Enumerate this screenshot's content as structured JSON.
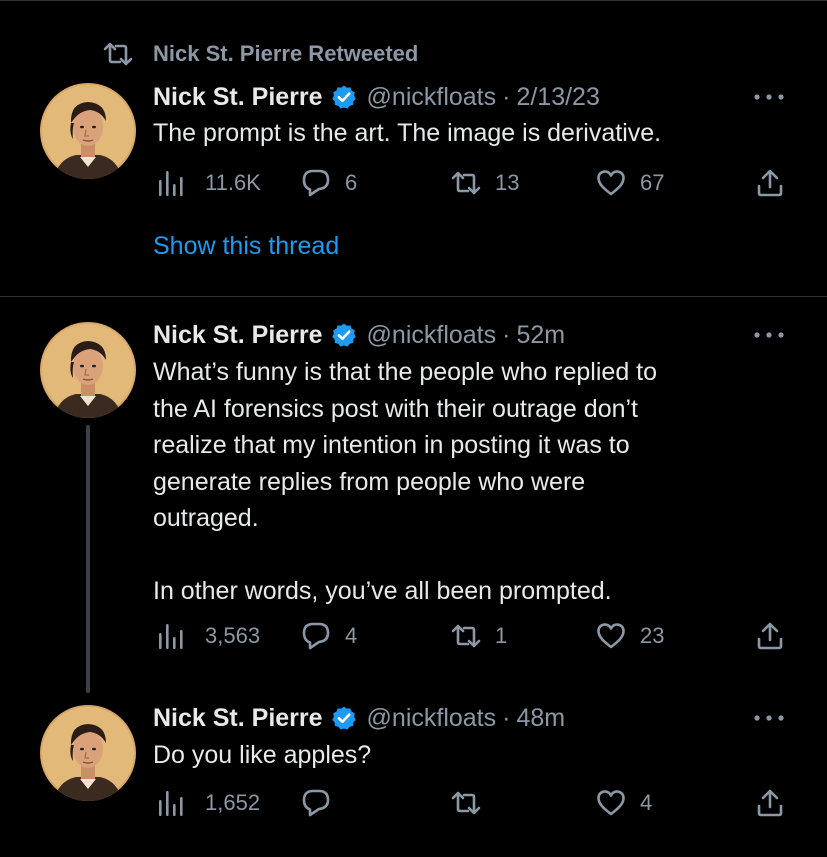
{
  "retweet_banner": {
    "text": "Nick St. Pierre Retweeted"
  },
  "tweets": [
    {
      "name": "Nick St. Pierre",
      "handle": "@nickfloats",
      "separator": "·",
      "time": "2/13/23",
      "text": "The prompt is the art. The image is derivative.",
      "views": "11.6K",
      "replies": "6",
      "retweets": "13",
      "likes": "67",
      "show_thread": "Show this thread"
    },
    {
      "name": "Nick St. Pierre",
      "handle": "@nickfloats",
      "separator": "·",
      "time": "52m",
      "text": "What’s funny is that the people who replied to\nthe AI forensics post with their outrage don’t\nrealize that my intention in posting it was to\ngenerate replies from people who were\noutraged.\n\nIn other words, you’ve all been prompted.",
      "views": "3,563",
      "replies": "4",
      "retweets": "1",
      "likes": "23"
    },
    {
      "name": "Nick St. Pierre",
      "handle": "@nickfloats",
      "separator": "·",
      "time": "48m",
      "text": "Do you like apples?",
      "views": "1,652",
      "replies": "",
      "retweets": "",
      "likes": "4"
    }
  ],
  "icons": {
    "retweet": "retweet-icon",
    "verified": "verified-badge-icon",
    "more": "more-icon",
    "views": "views-icon",
    "reply": "reply-icon",
    "like": "like-icon",
    "share": "share-icon"
  },
  "colors": {
    "background": "#000000",
    "text": "#e7e9ea",
    "muted": "#8b98a5",
    "link": "#1d9bf0",
    "verified": "#1d9bf0",
    "divider": "#2f3336"
  }
}
